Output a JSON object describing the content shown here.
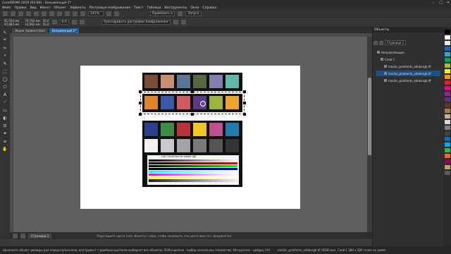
{
  "window": {
    "title": "CorelDRAW 2019 (64-Bit) - Безымянный-1*",
    "controls": [
      "–",
      "□",
      "✕"
    ]
  },
  "menu": [
    "Файл",
    "Правка",
    "Вид",
    "Макет",
    "Объект",
    "Эффекты",
    "Растровые изображения",
    "Текст",
    "Таблица",
    "Инструменты",
    "Окно",
    "Справка"
  ],
  "toolbar": {
    "zoom": "141%",
    "snap": "Привязать к",
    "launch": "Запуск"
  },
  "propbar": {
    "x": "81,504 мм",
    "y": "93,883 мм",
    "w": "79,792 мм",
    "h": "14,992 мм",
    "sx": "50,0",
    "sy": "50,0",
    "angle": "0,0",
    "trace_button": "Трассировать растровое изображение"
  },
  "tabs": [
    {
      "label": "Экран приветствия",
      "active": false
    },
    {
      "label": "Безымянный-1*",
      "active": true
    }
  ],
  "tools": [
    "↖",
    "⌖",
    "✂",
    "⌕",
    "✎",
    "⬚",
    "◯",
    "⬠",
    "A",
    "⟋",
    "▭",
    "◐",
    "⊡",
    "✦",
    "⌀",
    "✋"
  ],
  "canvas": {
    "cursor_label": "Lab Converted to Adobe rgb"
  },
  "swatches": {
    "row1": [
      "#7a4b35",
      "#c98f73",
      "#5a7596",
      "#55693c",
      "#7f7fb0",
      "#5fb8a8"
    ],
    "row2": [
      "#e08526",
      "#3a5aa8",
      "#cf5b5e",
      "#5c3b84",
      "#9cb43a",
      "#eca529"
    ],
    "row3": [
      "#2c3f93",
      "#3f8c44",
      "#b8333a",
      "#f0c622",
      "#c04f8f",
      "#1f7db0"
    ],
    "row4": [
      "#f2f2f2",
      "#c9c9c9",
      "#a3a3a3",
      "#7a7a7a",
      "#555555",
      "#333333"
    ]
  },
  "pagebar": {
    "page_tab": "Страница 1",
    "hint": "Перетащите цвета (или объекты) сюда, чтобы сохранить эти цвета вместе с документом"
  },
  "dock": {
    "title": "Объекты",
    "page_select": "Страница 1",
    "layers": [
      {
        "label": "Направляющие",
        "indent": 0,
        "selected": false
      },
      {
        "label": "Слой 1",
        "indent": 1,
        "selected": false
      },
      {
        "label": "macbc_gradients_adobergb.tif",
        "indent": 2,
        "selected": false
      },
      {
        "label": "macbc_gradients_adobergb.tif",
        "indent": 2,
        "selected": true
      },
      {
        "label": "macbc_gradients_adobergb.tif",
        "indent": 2,
        "selected": false
      }
    ]
  },
  "status": {
    "text": "Щелкните объект дважды для поворота/наклона; инструмент с двойным щелчком выбирает все объекты; Shift+щелчок - выбор нескольких элементов; Alt+щелчок - цифры; Ctrl+щелчок - выбор в группе",
    "file": "macbc_gradients_adobergb.tif (RGB) вкл. Слой 1 384 x 384 точек на дюйм"
  },
  "palette_colors": [
    "#000000",
    "#ffffff",
    "#e6e6e6",
    "#1f5fbf",
    "#2aa7df",
    "#00a651",
    "#8dc63f",
    "#fff200",
    "#f7941d",
    "#ed1c24",
    "#ec008c",
    "#92278f",
    "#662d91",
    "#603913",
    "#a67c52",
    "#c7b299",
    "#d9d9d9",
    "#808080",
    "#404040",
    "#0072bc",
    "#00aeef",
    "#39b54a",
    "#f26522",
    "#9e005d",
    "#c69c6d",
    "#5a5a5a"
  ]
}
